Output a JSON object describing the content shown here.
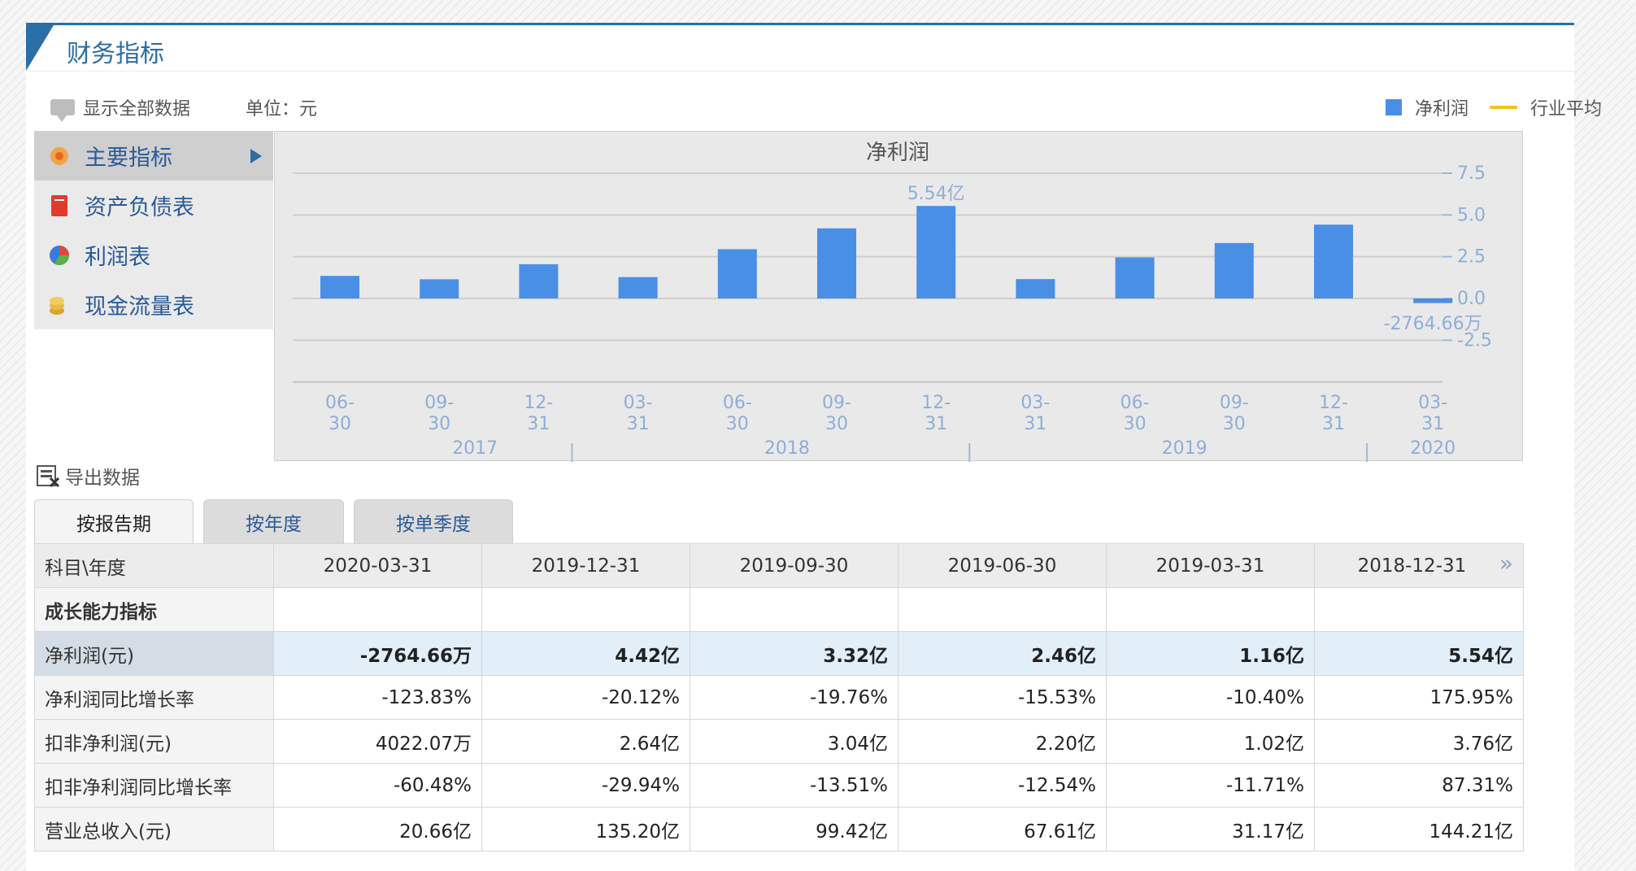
{
  "panel": {
    "title": "财务指标"
  },
  "toolbar": {
    "show_all": "显示全部数据",
    "unit": "单位：元"
  },
  "legend": {
    "series": "净利润",
    "avg": "行业平均"
  },
  "menu": {
    "items": [
      {
        "label": "主要指标"
      },
      {
        "label": "资产负债表"
      },
      {
        "label": "利润表"
      },
      {
        "label": "现金流量表"
      }
    ]
  },
  "chart_data": {
    "type": "bar",
    "title": "净利润",
    "categories": [
      [
        "06-",
        "30"
      ],
      [
        "09-",
        "30"
      ],
      [
        "12-",
        "31"
      ],
      [
        "03-",
        "31"
      ],
      [
        "06-",
        "30"
      ],
      [
        "09-",
        "30"
      ],
      [
        "12-",
        "31"
      ],
      [
        "03-",
        "31"
      ],
      [
        "06-",
        "30"
      ],
      [
        "09-",
        "30"
      ],
      [
        "12-",
        "31"
      ],
      [
        "03-",
        "31"
      ]
    ],
    "years": [
      {
        "label": "2017",
        "from": 0,
        "to": 2
      },
      {
        "label": "2018",
        "from": 3,
        "to": 6
      },
      {
        "label": "2019",
        "from": 7,
        "to": 10
      },
      {
        "label": "2020",
        "from": 11,
        "to": 11
      }
    ],
    "series": [
      {
        "name": "净利润",
        "values": [
          1.35,
          1.15,
          2.05,
          1.28,
          2.95,
          4.2,
          5.54,
          1.16,
          2.46,
          3.32,
          4.42,
          -0.276
        ]
      }
    ],
    "data_labels": [
      {
        "index": 6,
        "text": "5.54亿"
      },
      {
        "index": 11,
        "text": "-2764.66万"
      }
    ],
    "yticks": [
      "7.5",
      "5.0",
      "2.5",
      "0.0",
      "-2.5"
    ],
    "ytick_values": [
      7.5,
      5.0,
      2.5,
      0.0,
      -2.5
    ],
    "ylim": [
      -5,
      7.5
    ],
    "colors": {
      "bar": "#4a8fe6",
      "avg": "#f3c11a"
    }
  },
  "export": {
    "label": "导出数据"
  },
  "tabs": [
    {
      "label": "按报告期"
    },
    {
      "label": "按年度"
    },
    {
      "label": "按单季度"
    }
  ],
  "table": {
    "header": [
      "科目\\年度",
      "2020-03-31",
      "2019-12-31",
      "2019-09-30",
      "2019-06-30",
      "2019-03-31",
      "2018-12-31"
    ],
    "more": "»",
    "rows": [
      {
        "cells": [
          "成长能力指标",
          "",
          "",
          "",
          "",
          "",
          ""
        ]
      },
      {
        "cells": [
          "净利润(元)",
          "-2764.66万",
          "4.42亿",
          "3.32亿",
          "2.46亿",
          "1.16亿",
          "5.54亿"
        ]
      },
      {
        "cells": [
          "净利润同比增长率",
          "-123.83%",
          "-20.12%",
          "-19.76%",
          "-15.53%",
          "-10.40%",
          "175.95%"
        ]
      },
      {
        "cells": [
          "扣非净利润(元)",
          "4022.07万",
          "2.64亿",
          "3.04亿",
          "2.20亿",
          "1.02亿",
          "3.76亿"
        ]
      },
      {
        "cells": [
          "扣非净利润同比增长率",
          "-60.48%",
          "-29.94%",
          "-13.51%",
          "-12.54%",
          "-11.71%",
          "87.31%"
        ]
      },
      {
        "cells": [
          "营业总收入(元)",
          "20.66亿",
          "135.20亿",
          "99.42亿",
          "67.61亿",
          "31.17亿",
          "144.21亿"
        ]
      }
    ]
  }
}
